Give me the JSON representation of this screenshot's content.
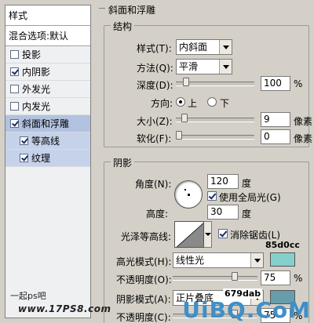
{
  "sidebar": {
    "header": "样式",
    "blend_options": "混合选项:默认",
    "items": [
      {
        "label": "投影",
        "checked": false
      },
      {
        "label": "内阴影",
        "checked": true
      },
      {
        "label": "外发光",
        "checked": false
      },
      {
        "label": "内发光",
        "checked": false
      },
      {
        "label": "斜面和浮雕",
        "checked": true
      },
      {
        "label": "等高线",
        "checked": true
      },
      {
        "label": "纹理",
        "checked": true
      }
    ],
    "footer_cn": "一起ps吧",
    "footer_url": "www.17PS8.com"
  },
  "bevel": {
    "title": "斜面和浮雕",
    "structure": {
      "legend": "结构",
      "style_label": "样式(T):",
      "style_value": "内斜面",
      "technique_label": "方法(Q):",
      "technique_value": "平滑",
      "depth_label": "深度(D):",
      "depth_value": "100",
      "depth_unit": "%",
      "depth_fraction": 0.1,
      "direction_label": "方向:",
      "direction_up": "上",
      "direction_down": "下",
      "size_label": "大小(Z):",
      "size_value": "9",
      "size_unit": "像素",
      "size_fraction": 0.08,
      "soften_label": "软化(F):",
      "soften_value": "0",
      "soften_unit": "像素",
      "soften_fraction": 0.0
    },
    "shading": {
      "legend": "阴影",
      "angle_label": "角度(N):",
      "angle_value": "120",
      "angle_unit": "度",
      "global_light_label": "使用全局光(G)",
      "altitude_label": "高度:",
      "altitude_value": "30",
      "altitude_unit": "度",
      "gloss_label": "光泽等高线:",
      "antialias_label": "消除锯齿(L)",
      "highlight_label": "高光模式(H):",
      "highlight_value": "线性光",
      "highlight_color": "#85d0cc",
      "highlight_color_annot": "85d0cc",
      "highlight_opacity_label": "不透明度(O):",
      "highlight_opacity_value": "75",
      "highlight_opacity_unit": "%",
      "shadow_label": "阴影模式(A):",
      "shadow_value": "正片叠底",
      "shadow_color": "#679dab",
      "shadow_color_annot": "679dab",
      "shadow_opacity_label": "不透明度(C):",
      "shadow_opacity_value": "75",
      "shadow_opacity_unit": "%"
    }
  },
  "watermark": "UiBQ.CoM"
}
